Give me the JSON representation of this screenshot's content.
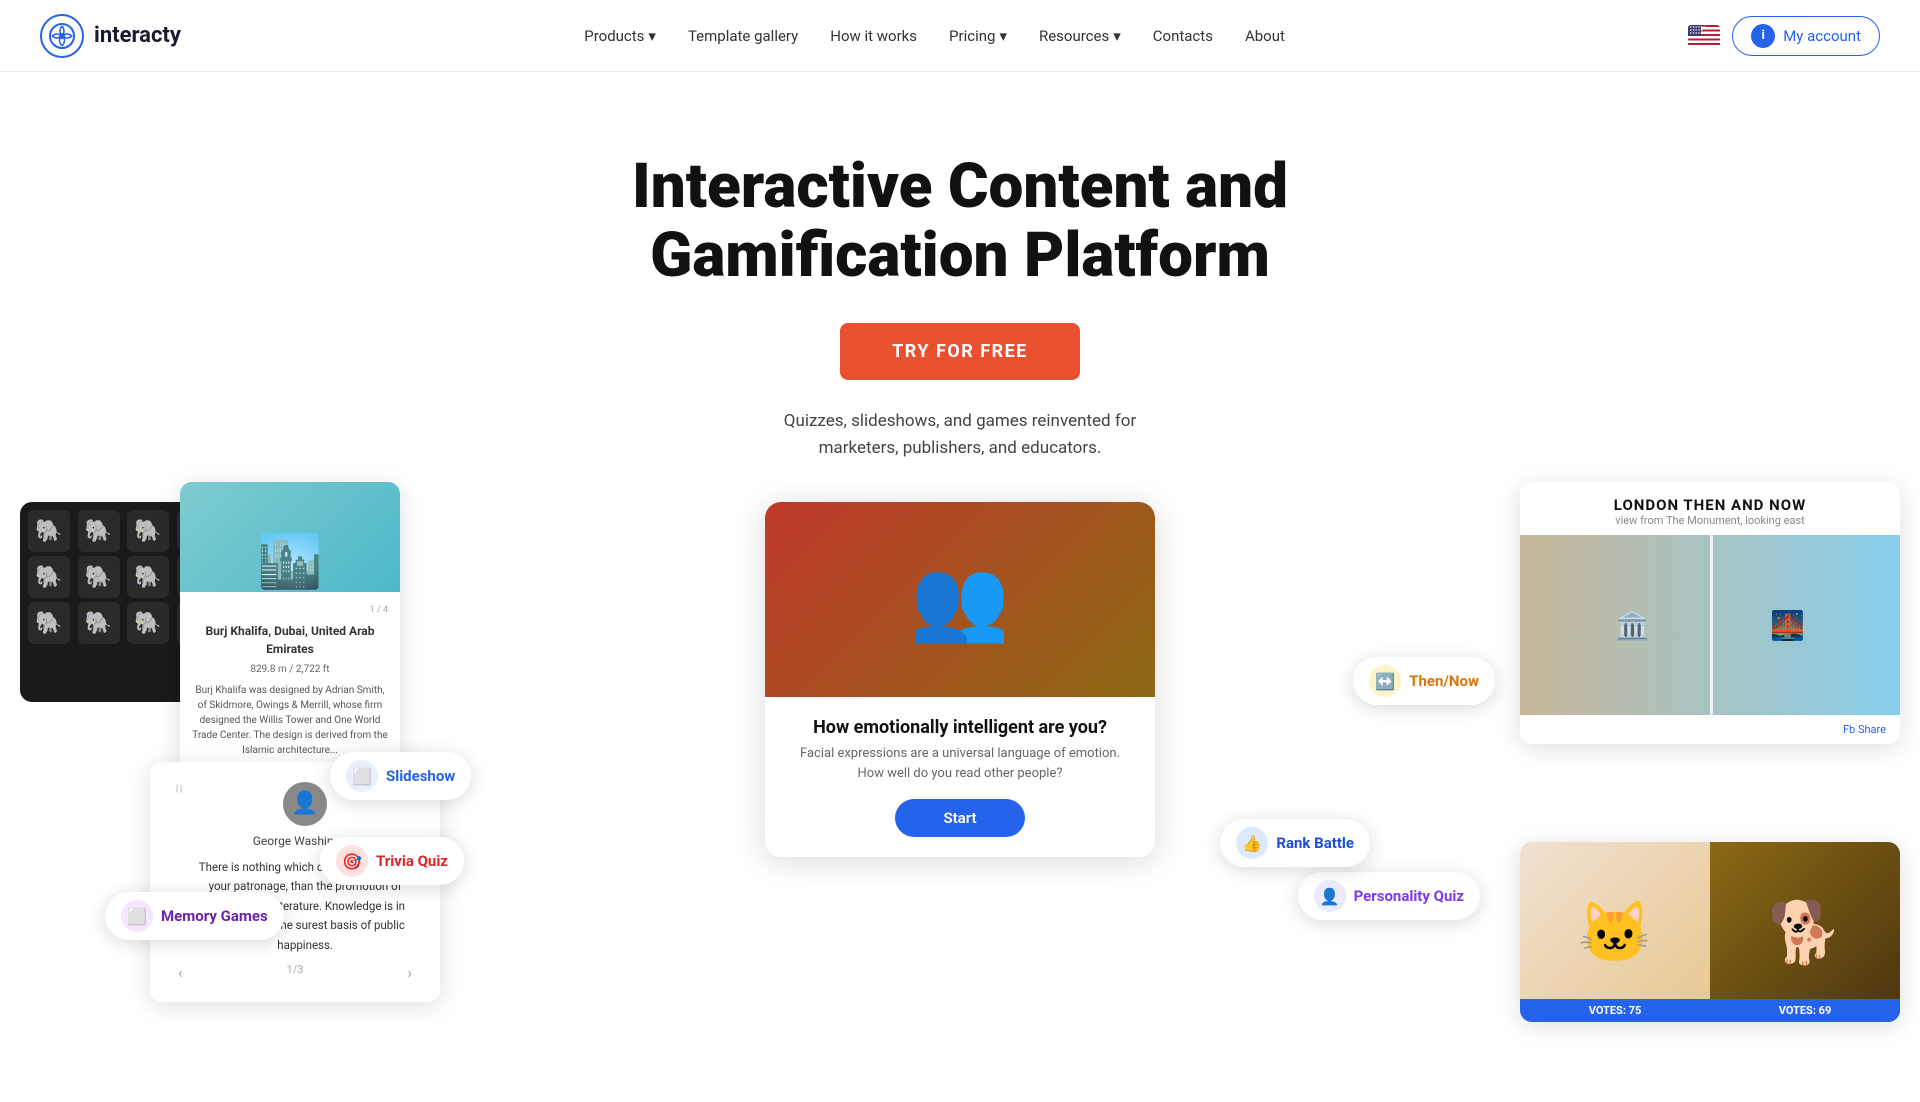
{
  "nav": {
    "logo_text": "interacty",
    "links": [
      {
        "label": "Products",
        "has_dropdown": true
      },
      {
        "label": "Template gallery",
        "has_dropdown": false
      },
      {
        "label": "How it works",
        "has_dropdown": false
      },
      {
        "label": "Pricing",
        "has_dropdown": true
      },
      {
        "label": "Resources",
        "has_dropdown": true
      },
      {
        "label": "Contacts",
        "has_dropdown": false
      },
      {
        "label": "About",
        "has_dropdown": false
      }
    ],
    "my_account_label": "My account"
  },
  "hero": {
    "title": "Interactive Content and Gamification Platform",
    "cta_label": "TRY FOR FREE",
    "subtitle": "Quizzes, slideshows, and games reinvented for\nmarketers, publishers, and educators."
  },
  "badges": {
    "slideshow": "Slideshow",
    "memory_games": "Memory Games",
    "trivia_quiz": "Trivia Quiz",
    "personality_quiz": "Personality Quiz",
    "rank_battle": "Rank Battle",
    "then_now": "Then/Now"
  },
  "slideshow_card": {
    "counter": "1 / 4",
    "title": "Burj Khalifa, Dubai, United Arab Emirates",
    "stats": "829.8 m / 2,722 ft",
    "body": "Burj Khalifa was designed by Adrian Smith, of Skidmore, Owings & Merrill, whose firm designed the Willis Tower and One World Trade Center. The design is derived from the Islamic architecture..."
  },
  "center_quiz": {
    "title": "How emotionally intelligent are you?",
    "subtitle": "Facial expressions are a universal language of emotion.\nHow well do you read other people?",
    "button": "Start"
  },
  "quote_card": {
    "name": "George Washington",
    "text": "There is nothing which can better deserve your patronage, than the promotion of Science and Literature. Knowledge is in every country the surest basis of public happiness.",
    "counter": "1/3"
  },
  "then_now_card": {
    "title": "LONDON THEN AND NOW",
    "subtitle": "view from The Monument, looking east"
  },
  "rank_battle": {
    "votes_left": "VOTES: 75",
    "votes_right": "VOTES: 69"
  },
  "colors": {
    "accent": "#2563eb",
    "cta": "#e85030",
    "purple": "#7c3aed"
  }
}
